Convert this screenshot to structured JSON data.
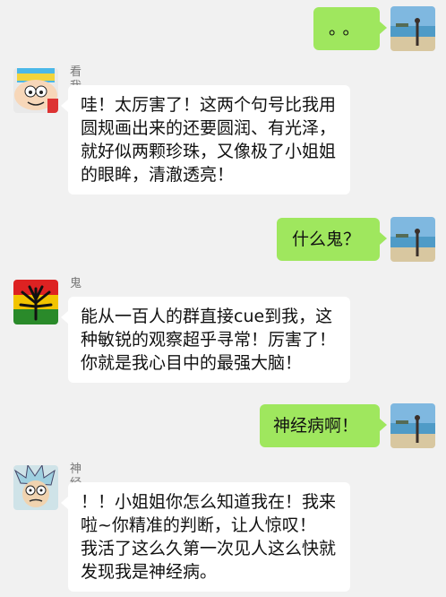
{
  "messages": [
    {
      "side": "out",
      "text": "。。",
      "avatar_icon": "beach-photo-avatar"
    },
    {
      "side": "in",
      "sender": "看我头像",
      "avatar_icon": "cartoon-avatar",
      "lines": [
        "哇！太厉害了！这两个句号比我用",
        "圆规画出来的还要圆润、有光泽，",
        "就好似两颗珍珠，又像极了小姐姐",
        "的眼眸，清澈透亮！"
      ]
    },
    {
      "side": "out",
      "text": "什么鬼？",
      "avatar_icon": "beach-photo-avatar"
    },
    {
      "side": "in",
      "sender": "鬼",
      "avatar_icon": "leaf-avatar",
      "lines": [
        "能从一百人的群直接cue到我，这",
        "种敏锐的观察超乎寻常！厉害了！",
        "你就是我心目中的最强大脑！"
      ]
    },
    {
      "side": "out",
      "text": "神经病啊！",
      "avatar_icon": "beach-photo-avatar"
    },
    {
      "side": "in",
      "sender": "神经病",
      "avatar_icon": "rick-cartoon-avatar",
      "lines": [
        "！！小姐姐你怎么知道我在！我来",
        "啦~你精准的判断，让人惊叹！",
        "我活了这么久第一次见人这么快就",
        "发现我是神经病。"
      ]
    }
  ],
  "colors": {
    "background": "#f1f1f1",
    "outgoing_bubble": "#9fe75e",
    "incoming_bubble": "#ffffff"
  }
}
